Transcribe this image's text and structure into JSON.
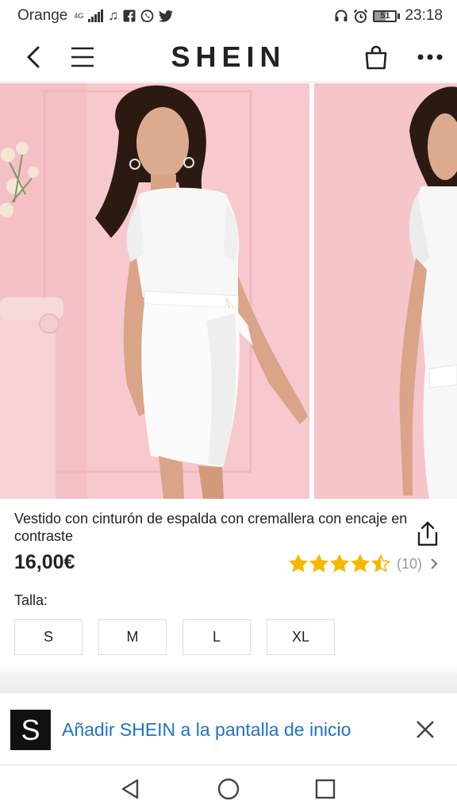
{
  "status_bar": {
    "carrier": "Orange",
    "network_type": "4G",
    "notification_icons": [
      "music-note-icon",
      "facebook-icon",
      "whatsapp-icon",
      "twitter-icon"
    ],
    "right_icons": [
      "headphones-icon",
      "alarm-icon"
    ],
    "battery_level": "51",
    "time": "23:18"
  },
  "header": {
    "brand": "SHEIN",
    "back_icon": "chevron-left-icon",
    "menu_icon": "hamburger-menu-icon",
    "bag_icon": "shopping-bag-icon",
    "more_icon": "more-dots-icon"
  },
  "gallery": {
    "images": [
      {
        "name": "product-photo-front",
        "description_icon": "dress-photo"
      },
      {
        "name": "product-photo-side",
        "description_icon": "dress-photo"
      }
    ],
    "colors": {
      "backdrop": "#f7c9ce",
      "dress": "#fbfbfb",
      "skin": "#d9a487",
      "hair": "#2b1a12"
    }
  },
  "product": {
    "title": "Vestido con cinturón de espalda con cremallera con encaje en contraste",
    "price": "16,00€",
    "rating": 4.5,
    "rating_max": 5,
    "review_count": "(10)",
    "size_label": "Talla:",
    "sizes": [
      "S",
      "M",
      "L",
      "XL"
    ],
    "star_color": "#f5b800"
  },
  "banner": {
    "logo_letter": "S",
    "text": "Añadir SHEIN a la pantalla de inicio",
    "text_color": "#1e73c8"
  },
  "nav_bar": {
    "buttons": [
      "back-triangle-icon",
      "home-circle-icon",
      "recents-square-icon"
    ]
  }
}
